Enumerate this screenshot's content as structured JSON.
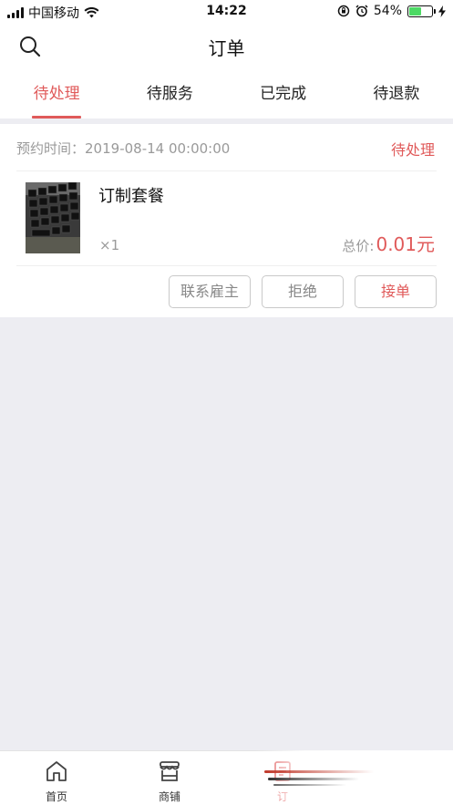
{
  "status_bar": {
    "carrier": "中国移动",
    "time": "14:22",
    "battery_percent": "54%",
    "battery_level": 0.54,
    "icons": [
      "signal-icon",
      "wifi-icon",
      "rotation-lock-icon",
      "alarm-icon",
      "battery-icon",
      "charging-icon"
    ]
  },
  "header": {
    "title": "订单",
    "search_icon": "search-icon"
  },
  "tabs": [
    {
      "label": "待处理",
      "active": true
    },
    {
      "label": "待服务",
      "active": false
    },
    {
      "label": "已完成",
      "active": false
    },
    {
      "label": "待退款",
      "active": false
    }
  ],
  "order": {
    "time_label": "预约时间：",
    "time_value": "2019-08-14 00:00:00",
    "status": "待处理",
    "item": {
      "name": "订制套餐",
      "quantity": "×1",
      "total_label": "总价:",
      "price": "0.01元"
    },
    "actions": {
      "contact": "联系雇主",
      "reject": "拒绝",
      "accept": "接单"
    }
  },
  "bottom_nav": {
    "items": [
      {
        "label": "首页",
        "icon": "home-icon"
      },
      {
        "label": "商铺",
        "icon": "store-icon"
      },
      {
        "label": "订",
        "icon": "orders-icon",
        "active": true
      }
    ]
  },
  "colors": {
    "accent": "#e05a5a",
    "background": "#ededf2"
  }
}
